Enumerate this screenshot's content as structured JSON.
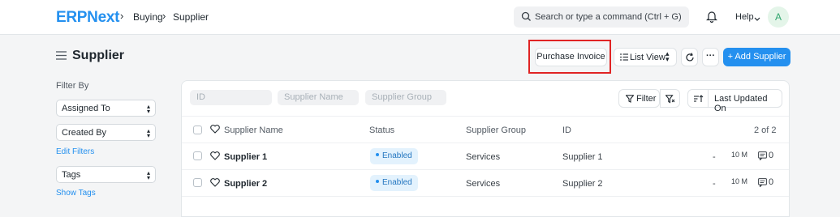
{
  "navbar": {
    "logo": "ERPNext",
    "breadcrumbs": [
      "Buying",
      "Supplier"
    ],
    "search_placeholder": "Search or type a command (Ctrl + G)",
    "help_label": "Help",
    "avatar_initial": "A"
  },
  "page": {
    "title": "Supplier",
    "buttons": {
      "purchase_invoice": "Purchase Invoice",
      "list_view": "List View",
      "more": "···",
      "add": "+ Add Supplier"
    }
  },
  "sidebar": {
    "filter_by_label": "Filter By",
    "assigned_to": "Assigned To",
    "created_by": "Created By",
    "edit_filters": "Edit Filters",
    "tags": "Tags",
    "show_tags": "Show Tags"
  },
  "list": {
    "filter_inputs": {
      "id": "ID",
      "supplier_name": "Supplier Name",
      "supplier_group": "Supplier Group"
    },
    "filter_label": "Filter",
    "sort_label": "Last Updated On",
    "columns": {
      "name": "Supplier Name",
      "status": "Status",
      "group": "Supplier Group",
      "id": "ID"
    },
    "count": "2 of 2",
    "rows": [
      {
        "name": "Supplier 1",
        "status": "Enabled",
        "group": "Services",
        "id": "Supplier 1",
        "dash": "-",
        "modified": "10 M",
        "comments": "0"
      },
      {
        "name": "Supplier 2",
        "status": "Enabled",
        "group": "Services",
        "id": "Supplier 2",
        "dash": "-",
        "modified": "10 M",
        "comments": "0"
      }
    ]
  },
  "colors": {
    "brand": "#2490ef",
    "highlight": "#e02424",
    "status_enabled_bg": "#e3f2fd"
  },
  "icons": [
    "menu-icon",
    "search-icon",
    "bell-icon",
    "chevron-down-icon",
    "list-icon",
    "refresh-icon",
    "filter-icon",
    "filter-clear-icon",
    "sort-icon",
    "heart-icon",
    "comment-icon"
  ]
}
